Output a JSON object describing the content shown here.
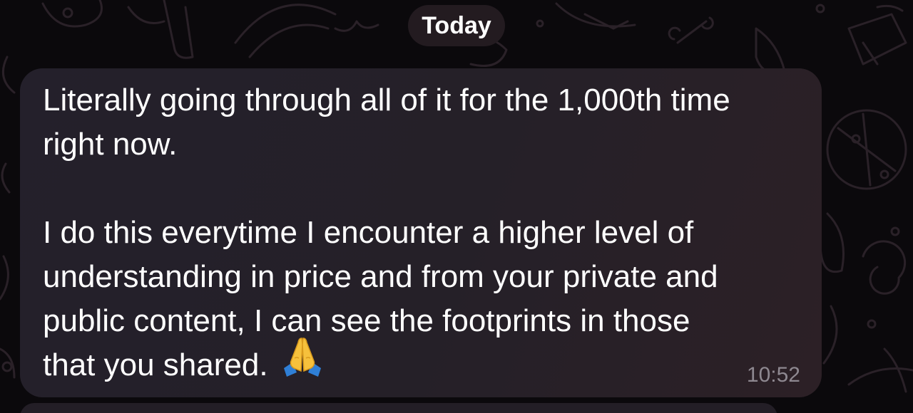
{
  "date_separator": {
    "label": "Today"
  },
  "message": {
    "paragraphs": [
      {
        "lines": [
          "Literally going through all of it for the 1,000th time",
          "right now."
        ]
      },
      {
        "lines": [
          "I do this everytime I encounter a higher level of",
          "understanding in price and from your private and",
          "public content, I can see the footprints in those",
          "that you shared."
        ]
      }
    ],
    "emoji": "folded-hands-emoji",
    "time": "10:52"
  },
  "colors": {
    "background": "#0b090c",
    "bubble": "#252028",
    "text": "#ffffff",
    "timestamp": "#8e8890",
    "date_pill": "#231b20"
  }
}
